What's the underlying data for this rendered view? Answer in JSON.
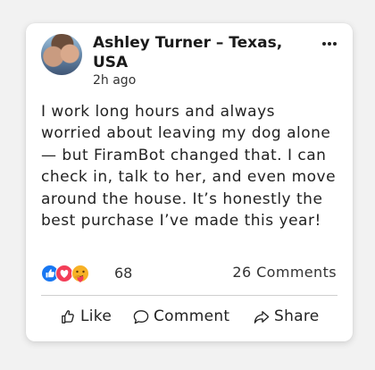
{
  "post": {
    "author": "Ashley Turner – Texas, USA",
    "time": "2h ago",
    "more_icon": "more-horizontal-icon",
    "text": "I work long hours and always worried about leaving my dog alone — but FiramBot changed that. I can check in, talk to her, and even move around the house. It’s honestly the best purchase I’ve made this year!",
    "reactions": {
      "icons": [
        "like-reaction-icon",
        "love-reaction-icon",
        "care-reaction-icon"
      ],
      "count": "68"
    },
    "comments_count": "26 Comments"
  },
  "actions": {
    "like_label": "Like",
    "comment_label": "Comment",
    "share_label": "Share"
  },
  "colors": {
    "like_blue": "#1877f2",
    "love_red": "#f33e58",
    "care_yellow": "#f7b125"
  }
}
